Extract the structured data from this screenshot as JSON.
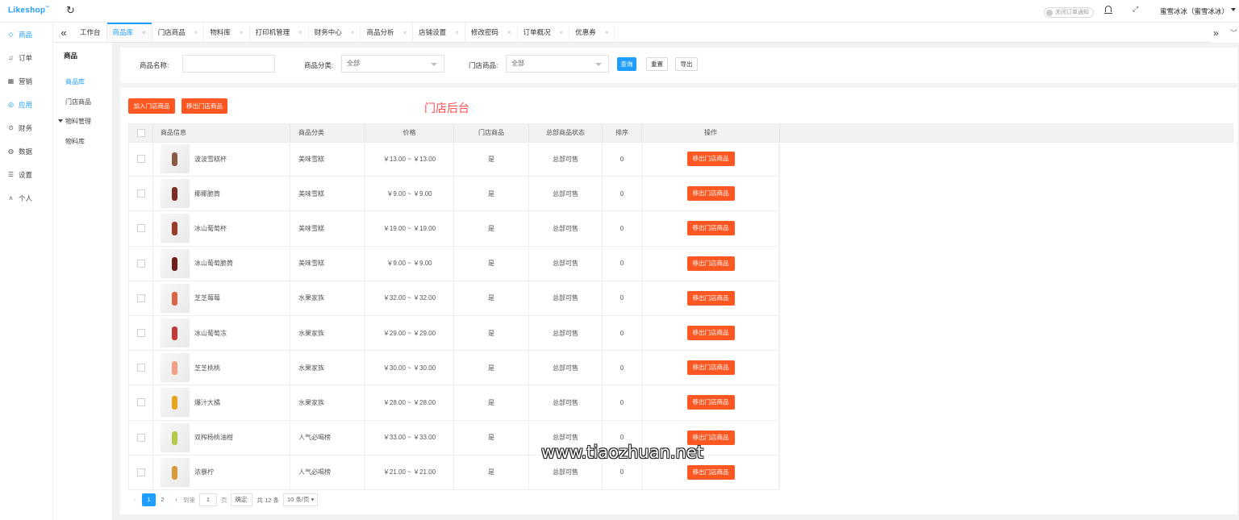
{
  "brand": {
    "logo": "Likeshop",
    "mark": "™",
    "color": "#1e9fff"
  },
  "header": {
    "refresh_icon": "refresh-icon",
    "notice_toggle": "关闭订单通知",
    "bell_icon": "bell-icon",
    "fullscreen_icon": "fullscreen-icon",
    "user": "蜜雪冰冰（蜜雪冰冰）"
  },
  "sidebar": {
    "items": [
      {
        "label": "商品",
        "icon": "diamond-icon",
        "glyph": "◇"
      },
      {
        "label": "订单",
        "icon": "bell-icon",
        "glyph": "♫"
      },
      {
        "label": "营销",
        "icon": "grid-icon",
        "glyph": "▦"
      },
      {
        "label": "应用",
        "icon": "shield-icon",
        "glyph": "◎"
      },
      {
        "label": "财务",
        "icon": "coin-icon",
        "glyph": "⊙"
      },
      {
        "label": "数据",
        "icon": "chart-icon",
        "glyph": "◍"
      },
      {
        "label": "设置",
        "icon": "settings-icon",
        "glyph": "☰"
      },
      {
        "label": "个人",
        "icon": "user-icon",
        "glyph": "ᴧ"
      }
    ]
  },
  "tabs": [
    "工作台",
    "商品库",
    "门店商品",
    "物料库",
    "打印机管理",
    "财务中心",
    "商品分析",
    "店铺设置",
    "修改密码",
    "订单概况",
    "优惠券"
  ],
  "subnav": {
    "title": "商品",
    "items": [
      "商品库",
      "门店商品"
    ],
    "group": "物料管理",
    "group_items": [
      "物料库"
    ]
  },
  "filter": {
    "name_label": "商品名称:",
    "name_value": "",
    "category_label": "商品分类:",
    "category_value": "全部",
    "store_label": "门店商品:",
    "store_value": "全部",
    "search_btn": "查询",
    "reset_btn": "重置",
    "export_btn": "导出"
  },
  "actions": {
    "add": "加入门店商品",
    "remove": "移出门店商品"
  },
  "overlay_title": "门店后台",
  "table": {
    "headers": [
      "商品信息",
      "商品分类",
      "价格",
      "门店商品",
      "总部商品状态",
      "排序",
      "操作"
    ],
    "rows": [
      {
        "name": "波波雪糕杯",
        "category": "美味雪糕",
        "price": "￥13.00 ~ ￥13.00",
        "store": "是",
        "status": "总部可售",
        "sort": "0",
        "action": "移出门店商品",
        "color": "#8a5a44"
      },
      {
        "name": "椰椰脆筒",
        "category": "美味雪糕",
        "price": "￥9.00 ~ ￥9.00",
        "store": "是",
        "status": "总部可售",
        "sort": "0",
        "action": "移出门店商品",
        "color": "#7a2e25"
      },
      {
        "name": "冰山葡萄杯",
        "category": "美味雪糕",
        "price": "￥19.00 ~ ￥19.00",
        "store": "是",
        "status": "总部可售",
        "sort": "0",
        "action": "移出门店商品",
        "color": "#9c3a2c"
      },
      {
        "name": "冰山葡萄脆筒",
        "category": "美味雪糕",
        "price": "￥9.00 ~ ￥9.00",
        "store": "是",
        "status": "总部可售",
        "sort": "0",
        "action": "移出门店商品",
        "color": "#6e1f1c"
      },
      {
        "name": "芝芝莓莓",
        "category": "水果家族",
        "price": "￥32.00 ~ ￥32.00",
        "store": "是",
        "status": "总部可售",
        "sort": "0",
        "action": "移出门店商品",
        "color": "#d8654a"
      },
      {
        "name": "冰山葡萄冻",
        "category": "水果家族",
        "price": "￥29.00 ~ ￥29.00",
        "store": "是",
        "status": "总部可售",
        "sort": "0",
        "action": "移出门店商品",
        "color": "#c23b3b"
      },
      {
        "name": "芝芝桃桃",
        "category": "水果家族",
        "price": "￥30.00 ~ ￥30.00",
        "store": "是",
        "status": "总部可售",
        "sort": "0",
        "action": "移出门店商品",
        "color": "#f0a08a"
      },
      {
        "name": "爆汁大橘",
        "category": "水果家族",
        "price": "￥28.00 ~ ￥28.00",
        "store": "是",
        "status": "总部可售",
        "sort": "0",
        "action": "移出门店商品",
        "color": "#e8a41c"
      },
      {
        "name": "双榨杨桃油柑",
        "category": "人气必喝榜",
        "price": "￥33.00 ~ ￥33.00",
        "store": "是",
        "status": "总部可售",
        "sort": "0",
        "action": "移出门店商品",
        "color": "#b7c94a"
      },
      {
        "name": "浓暴柠",
        "category": "人气必喝榜",
        "price": "￥21.00 ~ ￥21.00",
        "store": "是",
        "status": "总部可售",
        "sort": "0",
        "action": "移出门店商品",
        "color": "#d99a3a"
      }
    ]
  },
  "pagination": {
    "prev": "‹",
    "pages": [
      "1",
      "2"
    ],
    "next": "›",
    "goto": "到第",
    "page_input": "1",
    "page_unit": "页",
    "confirm": "确定",
    "total": "共 12 条",
    "page_size": "10 条/页"
  },
  "watermark": "www.tiaozhuan.net"
}
